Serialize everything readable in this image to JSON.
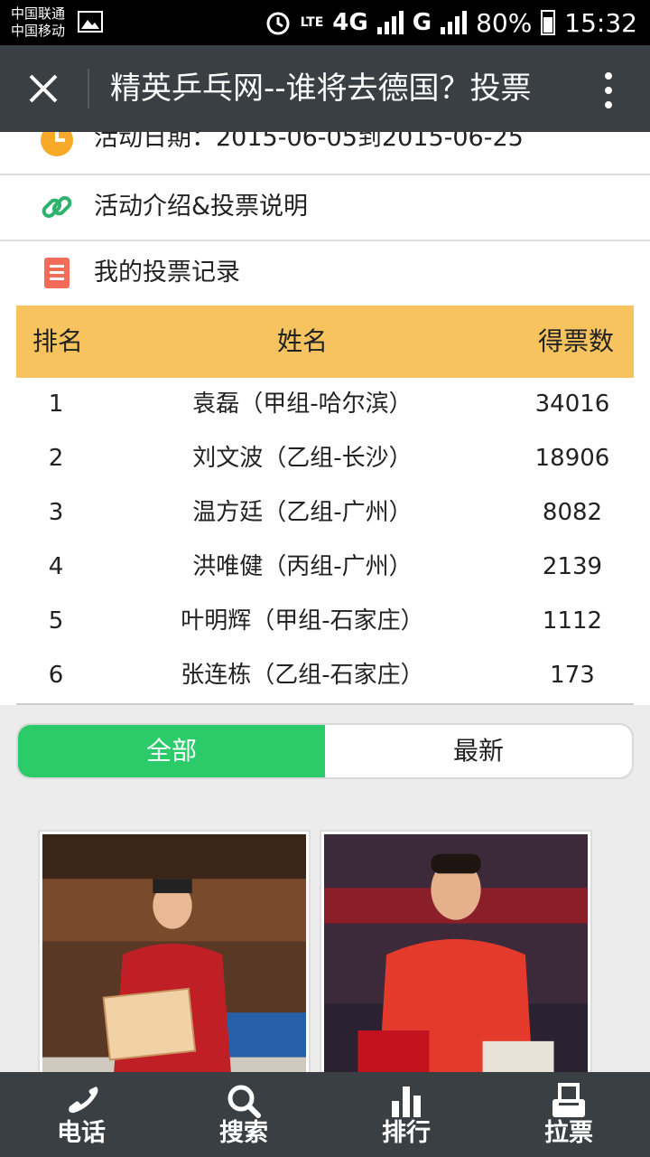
{
  "status_bar": {
    "carrier_line1": "中国联通",
    "carrier_line2": "中国移动",
    "network_1": "LTE",
    "network_2": "4G",
    "network_3": "G",
    "battery": "80%",
    "time": "15:32"
  },
  "title_bar": {
    "title": "精英乒乓网--谁将去德国？投票"
  },
  "menu": [
    {
      "label": "活动日期：2015-06-05到2015-06-25",
      "icon": "clock-icon"
    },
    {
      "label": "活动介绍&投票说明",
      "icon": "link-icon"
    },
    {
      "label": "我的投票记录",
      "icon": "list-icon"
    }
  ],
  "ranking": {
    "headers": [
      "排名",
      "姓名",
      "得票数"
    ],
    "rows": [
      {
        "rank": "1",
        "name": "袁磊（甲组-哈尔滨）",
        "votes": "34016"
      },
      {
        "rank": "2",
        "name": "刘文波（乙组-长沙）",
        "votes": "18906"
      },
      {
        "rank": "3",
        "name": "温方廷（乙组-广州）",
        "votes": "8082"
      },
      {
        "rank": "4",
        "name": "洪唯健（丙组-广州）",
        "votes": "2139"
      },
      {
        "rank": "5",
        "name": "叶明辉（甲组-石家庄）",
        "votes": "1112"
      },
      {
        "rank": "6",
        "name": "张连栋（乙组-石家庄）",
        "votes": "173"
      }
    ]
  },
  "tabs": {
    "all": "全部",
    "latest": "最新"
  },
  "bottom_nav": [
    {
      "label": "电话",
      "icon": "phone-icon"
    },
    {
      "label": "搜索",
      "icon": "search-icon"
    },
    {
      "label": "排行",
      "icon": "bar-chart-icon"
    },
    {
      "label": "拉票",
      "icon": "ballot-box-icon"
    }
  ],
  "colors": {
    "title_bar": "#3a3f44",
    "table_header": "#f6c35f",
    "tab_active": "#2bcb6a",
    "clock_icon": "#f7a928",
    "link_icon": "#2db36b",
    "list_icon": "#f36c5a"
  }
}
